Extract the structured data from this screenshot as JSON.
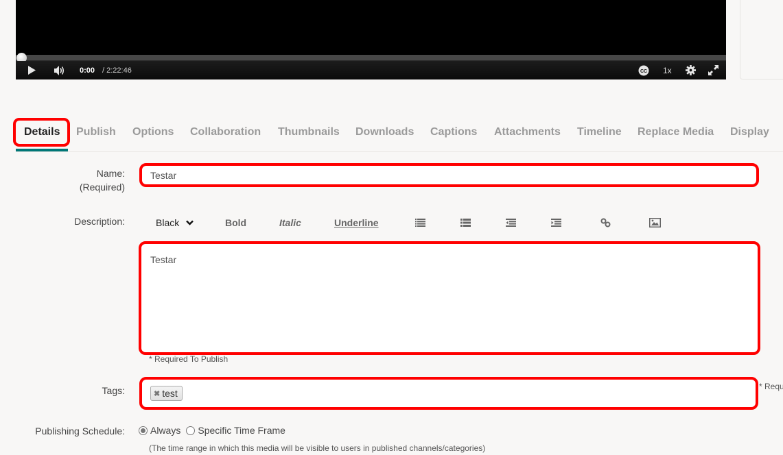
{
  "player": {
    "current_time": "0:00",
    "total_time": "/ 2:22:46",
    "progress_fraction": 0,
    "speed_label": "1x",
    "icons": [
      "play-icon",
      "volume-icon",
      "closed-captions-icon",
      "gear-icon",
      "fullscreen-icon"
    ]
  },
  "tabs": [
    {
      "label": "Details",
      "active": true
    },
    {
      "label": "Publish",
      "active": false
    },
    {
      "label": "Options",
      "active": false
    },
    {
      "label": "Collaboration",
      "active": false
    },
    {
      "label": "Thumbnails",
      "active": false
    },
    {
      "label": "Downloads",
      "active": false
    },
    {
      "label": "Captions",
      "active": false
    },
    {
      "label": "Attachments",
      "active": false
    },
    {
      "label": "Timeline",
      "active": false
    },
    {
      "label": "Replace Media",
      "active": false
    },
    {
      "label": "Display",
      "active": false
    }
  ],
  "form": {
    "name": {
      "label": "Name:",
      "sublabel": "(Required)",
      "value": "Testar"
    },
    "description": {
      "label": "Description:",
      "toolbar": {
        "color_select": "Black",
        "bold": "Bold",
        "italic": "Italic",
        "underline": "Underline",
        "icons": [
          "ordered-list-icon",
          "unordered-list-icon",
          "outdent-icon",
          "indent-icon",
          "link-icon",
          "image-icon"
        ]
      },
      "value": "Testar",
      "note": "* Required To Publish"
    },
    "tags": {
      "label": "Tags:",
      "items": [
        "test"
      ],
      "side_note": "* Requ"
    },
    "schedule": {
      "label": "Publishing Schedule:",
      "options": [
        {
          "label": "Always",
          "checked": true
        },
        {
          "label": "Specific Time Frame",
          "checked": false
        }
      ],
      "note": "(The time range in which this media will be visible to users in published channels/categories)"
    }
  },
  "colors": {
    "highlight": "#ff0000",
    "active_tab_underline": "#007777",
    "inactive_tab": "#9a9a9a"
  }
}
